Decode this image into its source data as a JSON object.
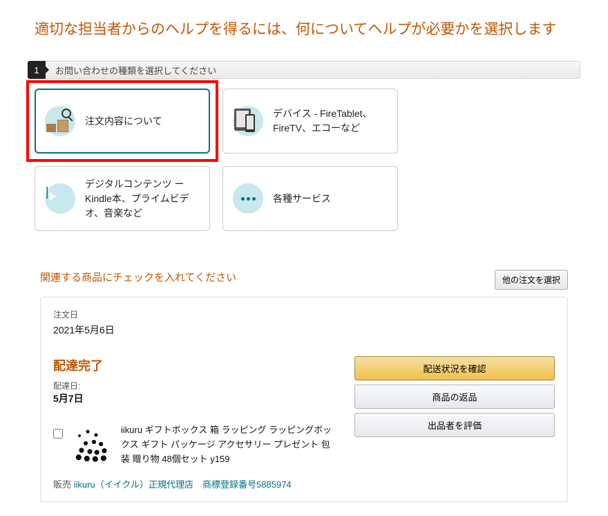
{
  "page": {
    "heading": "適切な担当者からのヘルプを得るには、何についてヘルプが必要かを選択します"
  },
  "step1": {
    "number": "1",
    "title": "お問い合わせの種類を選択してください"
  },
  "categories": [
    {
      "key": "order",
      "label": "注文内容について",
      "selected": true,
      "highlighted": true
    },
    {
      "key": "device",
      "label": "デバイス - FireTablet、FireTV、エコーなど",
      "selected": false,
      "highlighted": false
    },
    {
      "key": "digital",
      "label": "デジタルコンテンツ ーKindle本、プライムビデオ、音楽など",
      "selected": false,
      "highlighted": false
    },
    {
      "key": "services",
      "label": "各種サービス",
      "selected": false,
      "highlighted": false
    }
  ],
  "orderSection": {
    "title": "関連する商品にチェックを入れてください",
    "selectOtherOrder": "他の注文を選択"
  },
  "order": {
    "orderDateLabel": "注文日",
    "orderDateValue": "2021年5月6日",
    "deliveryStatus": "配達完了",
    "deliveryDateLabel": "配達日:",
    "deliveryDateValue": "5月7日",
    "product": {
      "name": "iikuru ギフトボックス 箱 ラッピング ラッピングボックス ギフト パッケージ アクセサリー プレゼント 包装 贈り物 48個セット y159"
    },
    "sellerPrefix": "販売 ",
    "sellerLink": "iikuru（イイクル）正規代理店　商標登録番号5885974",
    "actions": {
      "track": "配送状況を確認",
      "return": "商品の返品",
      "review": "出品者を評価"
    }
  }
}
